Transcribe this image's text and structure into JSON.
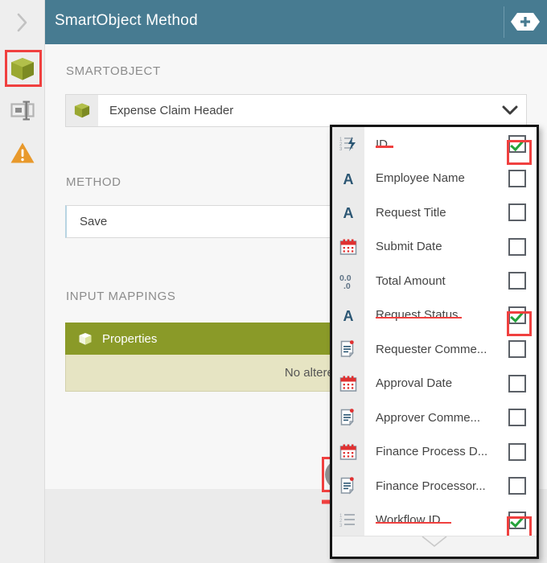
{
  "header": {
    "title": "SmartObject Method",
    "add_icon": "hexagon-plus-icon",
    "bg_color": "#477b91"
  },
  "rail": {
    "collapse_icon": "chevron-right-icon",
    "items": [
      {
        "icon": "cube-icon",
        "name": "smartobject",
        "selected": true
      },
      {
        "icon": "form-input-icon",
        "name": "form",
        "selected": false
      },
      {
        "icon": "warning-triangle-icon",
        "name": "errors",
        "selected": false
      }
    ],
    "selection_color": "#f0403f"
  },
  "main": {
    "smartobject": {
      "label": "SMARTOBJECT",
      "icon": "cube-icon",
      "value": "Expense Claim Header",
      "caret_icon": "chevron-down-icon"
    },
    "method": {
      "label": "METHOD",
      "value": "Save"
    },
    "input_mappings": {
      "label": "INPUT MAPPINGS",
      "card": {
        "icon": "cube-icon",
        "title": "Properties",
        "empty_text": "No altered properties",
        "header_color": "#8a9a28",
        "body_color": "#e6e4c3"
      },
      "add_button": {
        "icon": "plus-circle-icon",
        "highlighted": true,
        "annotation_icon": "red-arrow-right"
      }
    }
  },
  "popup": {
    "scroll_down_icon": "chevron-down-icon",
    "items": [
      {
        "icon": "autonumber-icon",
        "label": "ID",
        "checked": true,
        "underlined": true,
        "underline_width": 22
      },
      {
        "icon": "text-icon",
        "label": "Employee Name",
        "checked": false,
        "underlined": false,
        "underline_width": 0
      },
      {
        "icon": "text-icon",
        "label": "Request Title",
        "checked": false,
        "underlined": false,
        "underline_width": 0
      },
      {
        "icon": "date-icon",
        "label": "Submit Date",
        "checked": false,
        "underlined": false,
        "underline_width": 0
      },
      {
        "icon": "decimal-icon",
        "label": "Total Amount",
        "checked": false,
        "underlined": false,
        "underline_width": 0
      },
      {
        "icon": "text-icon",
        "label": "Request Status",
        "checked": true,
        "underlined": true,
        "underline_width": 107
      },
      {
        "icon": "memo-icon",
        "label": "Requester Comme...",
        "checked": false,
        "underlined": false,
        "underline_width": 0
      },
      {
        "icon": "date-icon",
        "label": "Approval Date",
        "checked": false,
        "underlined": false,
        "underline_width": 0
      },
      {
        "icon": "memo-icon",
        "label": "Approver Comme...",
        "checked": false,
        "underlined": false,
        "underline_width": 0
      },
      {
        "icon": "date-icon",
        "label": "Finance Process D...",
        "checked": false,
        "underlined": false,
        "underline_width": 0
      },
      {
        "icon": "memo-icon",
        "label": "Finance Processor...",
        "checked": false,
        "underlined": false,
        "underline_width": 0
      },
      {
        "icon": "number-list-icon",
        "label": "Workflow ID",
        "checked": true,
        "underlined": true,
        "underline_width": 94
      }
    ]
  }
}
